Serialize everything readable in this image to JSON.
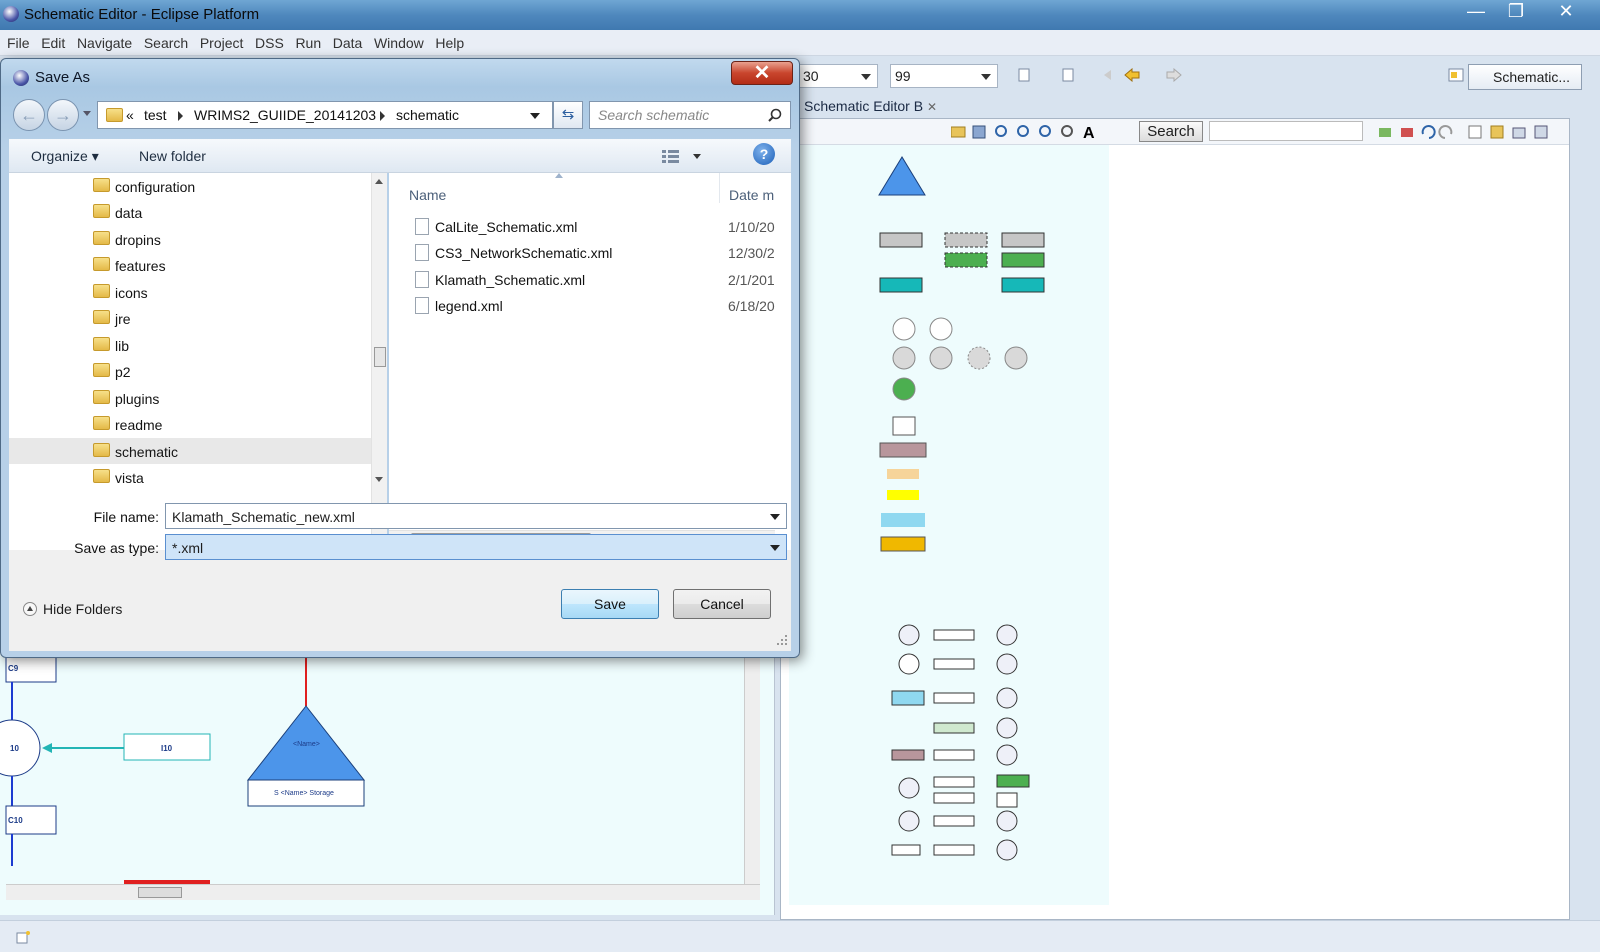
{
  "window": {
    "title": "Schematic Editor - Eclipse Platform"
  },
  "menu": [
    "File",
    "Edit",
    "Navigate",
    "Search",
    "Project",
    "DSS",
    "Run",
    "Data",
    "Window",
    "Help"
  ],
  "toolbar": {
    "combo1": "30",
    "combo2": "99",
    "perspective": "Schematic..."
  },
  "editor": {
    "tab_label": "Schematic Editor B",
    "search_button": "Search"
  },
  "canvas_left": {
    "node_i10": "I10",
    "node_c9": "C9",
    "node_10": "10",
    "node_c10": "C10",
    "storage_name": "<Name>",
    "storage_label": "S <Name> Storage"
  },
  "dialog": {
    "title": "Save As",
    "breadcrumb": [
      "«",
      "test",
      "WRIMS2_GUIIDE_20141203",
      "schematic"
    ],
    "search_placeholder": "Search schematic",
    "organize": "Organize",
    "new_folder": "New folder",
    "folders": [
      "configuration",
      "data",
      "dropins",
      "features",
      "icons",
      "jre",
      "lib",
      "p2",
      "plugins",
      "readme",
      "schematic",
      "vista"
    ],
    "selected_folder": "schematic",
    "columns": {
      "name": "Name",
      "date": "Date m"
    },
    "files": [
      {
        "name": "CalLite_Schematic.xml",
        "date": "1/10/20"
      },
      {
        "name": "CS3_NetworkSchematic.xml",
        "date": "12/30/2"
      },
      {
        "name": "Klamath_Schematic.xml",
        "date": "2/1/201"
      },
      {
        "name": "legend.xml",
        "date": "6/18/20"
      }
    ],
    "file_name_label": "File name:",
    "file_name_value": "Klamath_Schematic_new.xml",
    "save_type_label": "Save as type:",
    "save_type_value": "*.xml",
    "hide_folders": "Hide Folders",
    "save": "Save",
    "cancel": "Cancel"
  }
}
